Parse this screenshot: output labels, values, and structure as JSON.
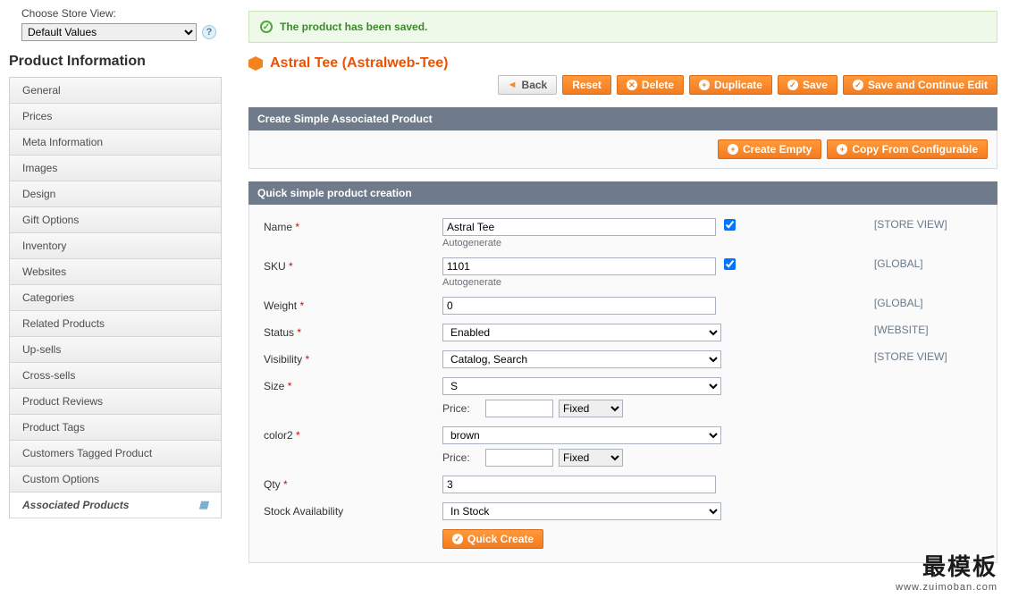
{
  "store_view": {
    "label": "Choose Store View:",
    "selected": "Default Values"
  },
  "section_title": "Product Information",
  "tabs": [
    {
      "label": "General"
    },
    {
      "label": "Prices"
    },
    {
      "label": "Meta Information"
    },
    {
      "label": "Images"
    },
    {
      "label": "Design"
    },
    {
      "label": "Gift Options"
    },
    {
      "label": "Inventory"
    },
    {
      "label": "Websites"
    },
    {
      "label": "Categories"
    },
    {
      "label": "Related Products"
    },
    {
      "label": "Up-sells"
    },
    {
      "label": "Cross-sells"
    },
    {
      "label": "Product Reviews"
    },
    {
      "label": "Product Tags"
    },
    {
      "label": "Customers Tagged Product"
    },
    {
      "label": "Custom Options"
    },
    {
      "label": "Associated Products"
    }
  ],
  "success_message": "The product has been saved.",
  "page_title": "Astral Tee (Astralweb-Tee)",
  "actions": {
    "back": "Back",
    "reset": "Reset",
    "delete": "Delete",
    "duplicate": "Duplicate",
    "save": "Save",
    "save_continue": "Save and Continue Edit"
  },
  "panels": {
    "create_simple": {
      "title": "Create Simple Associated Product",
      "create_empty": "Create Empty",
      "copy_from": "Copy From Configurable"
    },
    "quick": {
      "title": "Quick simple product creation",
      "quick_create": "Quick Create"
    }
  },
  "form": {
    "name": {
      "label": "Name",
      "value": "Astral Tee",
      "autogen": "Autogenerate",
      "scope": "[STORE VIEW]"
    },
    "sku": {
      "label": "SKU",
      "value": "1101",
      "autogen": "Autogenerate",
      "scope": "[GLOBAL]"
    },
    "weight": {
      "label": "Weight",
      "value": "0",
      "scope": "[GLOBAL]"
    },
    "status": {
      "label": "Status",
      "value": "Enabled",
      "scope": "[WEBSITE]"
    },
    "visibility": {
      "label": "Visibility",
      "value": "Catalog, Search",
      "scope": "[STORE VIEW]"
    },
    "size": {
      "label": "Size",
      "value": "S",
      "price_label": "Price:",
      "price_type": "Fixed"
    },
    "color2": {
      "label": "color2",
      "value": "brown",
      "price_label": "Price:",
      "price_type": "Fixed"
    },
    "qty": {
      "label": "Qty",
      "value": "3"
    },
    "stock": {
      "label": "Stock Availability",
      "value": "In Stock"
    }
  },
  "watermark": {
    "line1": "最模板",
    "line2": "www.zuimoban.com"
  }
}
